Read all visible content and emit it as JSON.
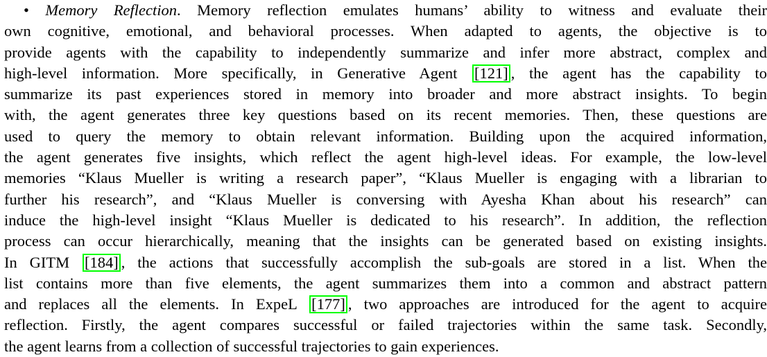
{
  "paragraph": {
    "bullet": "•",
    "heading": "Memory Reflection",
    "lines": [
      {
        "pre": ". Memory reflection emulates humans’ ability to witness and evaluate their"
      },
      {
        "pre": "own cognitive, emotional, and behavioral processes. When adapted to agents, the objective is to"
      },
      {
        "pre": "provide agents with the capability to independently summarize and infer more abstract, complex and"
      },
      {
        "pre": "high-level information. More specifically, in Generative Agent ",
        "cite": "[121]",
        "post": ", the agent has the capability to"
      },
      {
        "pre": "summarize its past experiences stored in memory into broader and more abstract insights. To begin"
      },
      {
        "pre": "with, the agent generates three key questions based on its recent memories. Then, these questions are"
      },
      {
        "pre": "used to query the memory to obtain relevant information. Building upon the acquired information,"
      },
      {
        "pre": "the agent generates five insights, which reflect the agent high-level ideas. For example, the low-level"
      },
      {
        "pre": "memories “Klaus Mueller is writing a research paper”, “Klaus Mueller is engaging with a librarian to"
      },
      {
        "pre": "further his research”, and “Klaus Mueller is conversing with Ayesha Khan about his research” can"
      },
      {
        "pre": "induce the high-level insight “Klaus Mueller is dedicated to his research”. In addition, the reflection"
      },
      {
        "pre": "process can occur hierarchically, meaning that the insights can be generated based on existing insights."
      },
      {
        "pre": "In GITM ",
        "cite": "[184]",
        "post": ", the actions that successfully accomplish the sub-goals are stored in a list. When the"
      },
      {
        "pre": "list contains more than five elements, the agent summarizes them into a common and abstract pattern"
      },
      {
        "pre": "and replaces all the elements. In ExpeL ",
        "cite": "[177]",
        "post": ", two approaches are introduced for the agent to acquire"
      },
      {
        "pre": "reflection. Firstly, the agent compares successful or failed trajectories within the same task. Secondly,"
      },
      {
        "pre": "the agent learns from a collection of successful trajectories to gain experiences."
      }
    ]
  },
  "colors": {
    "citation_box": "#00ff00",
    "text": "#000000"
  }
}
